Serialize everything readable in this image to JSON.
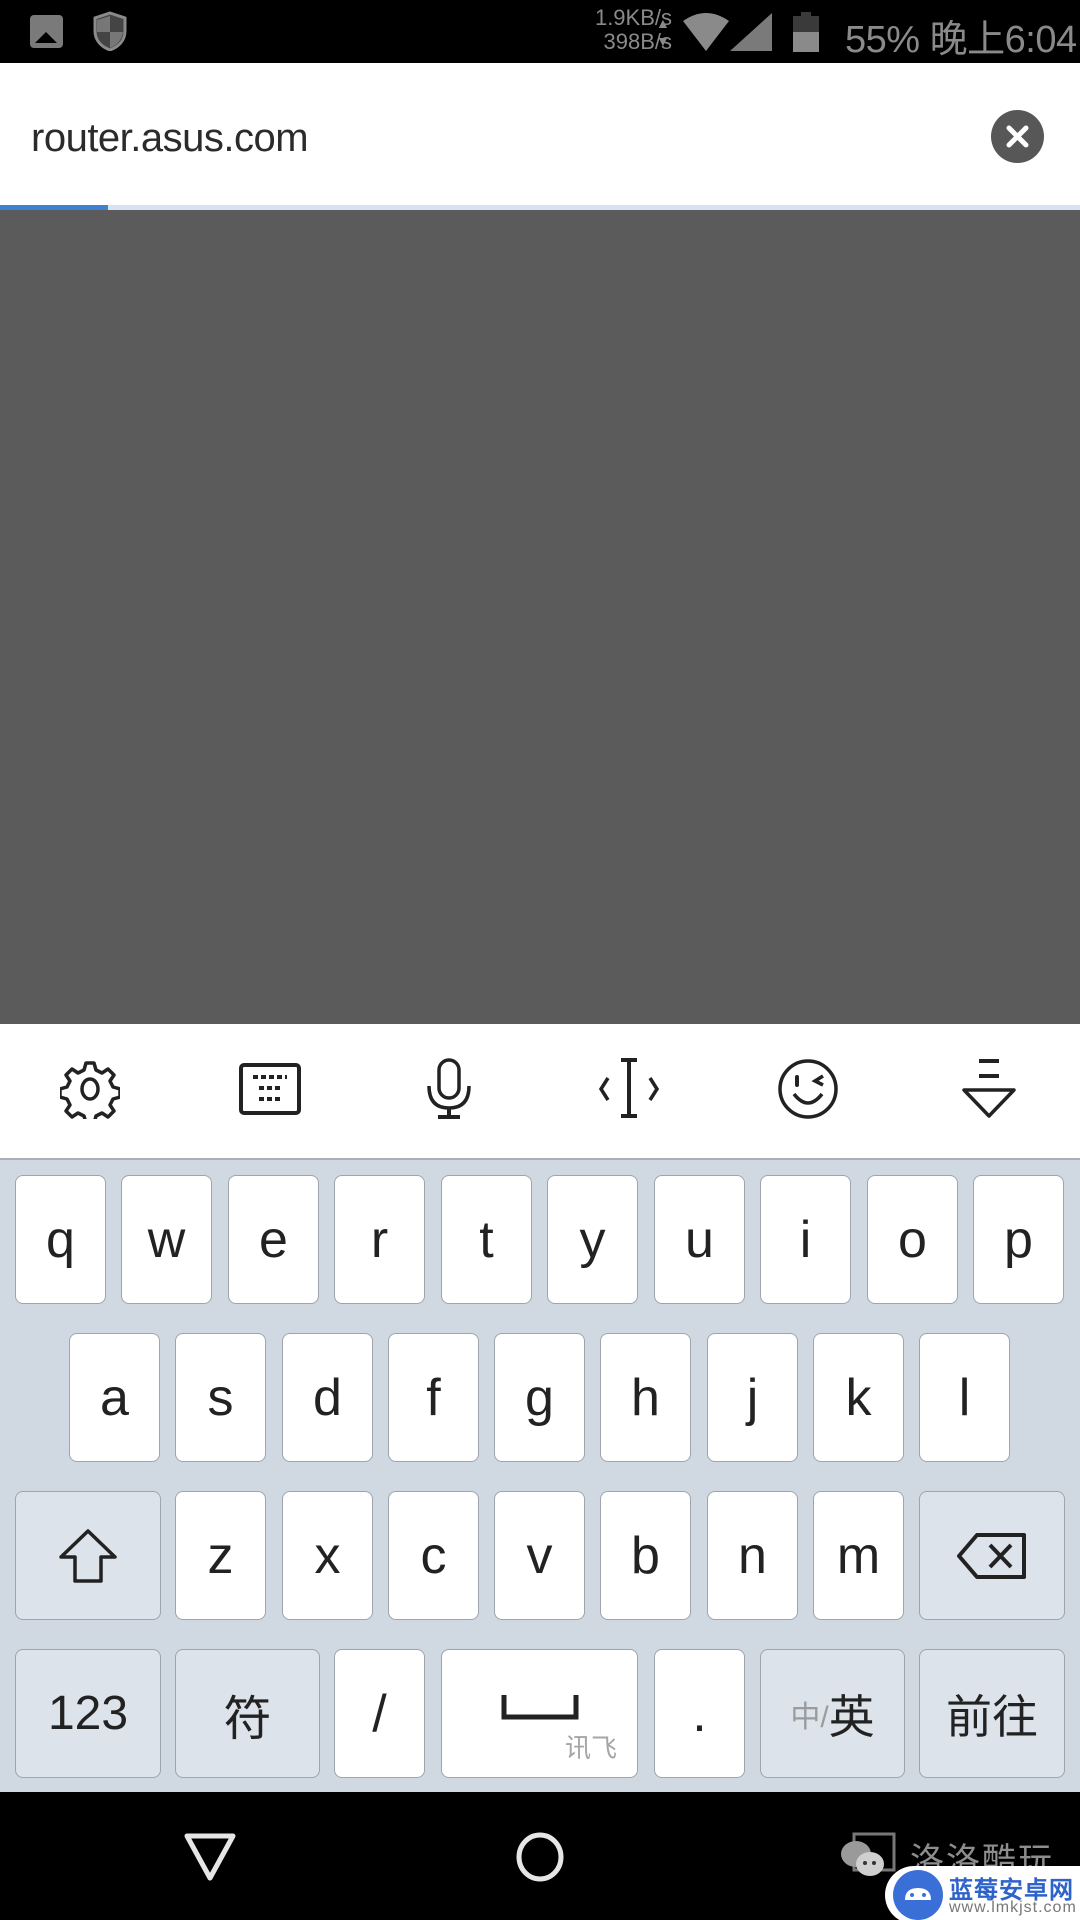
{
  "status_bar": {
    "icons": [
      "gallery-icon",
      "shield-icon",
      "wifi-icon",
      "cell-signal-icon",
      "battery-icon"
    ],
    "upload_speed": "1.9KB/s",
    "download_speed": "398B/s",
    "battery_percent": "55%",
    "time": "晚上6:04"
  },
  "url_bar": {
    "url": "router.asus.com",
    "clear_icon": "close-circle-icon",
    "load_progress": 0.1,
    "colors": {
      "progress": "#3f7fd4",
      "track": "#d6e2f5"
    }
  },
  "page": {
    "background": "#5b5b5b"
  },
  "keyboard_toolbar": {
    "tools": [
      {
        "name": "settings",
        "icon": "gear-icon"
      },
      {
        "name": "keyboard-layout",
        "icon": "keyboard-icon"
      },
      {
        "name": "voice-input",
        "icon": "microphone-icon"
      },
      {
        "name": "cursor-move",
        "icon": "text-cursor-icon"
      },
      {
        "name": "emoji",
        "icon": "wink-face-icon"
      },
      {
        "name": "hide-keyboard",
        "icon": "collapse-down-icon"
      }
    ]
  },
  "keyboard": {
    "row1": [
      "q",
      "w",
      "e",
      "r",
      "t",
      "y",
      "u",
      "i",
      "o",
      "p"
    ],
    "row2": [
      "a",
      "s",
      "d",
      "f",
      "g",
      "h",
      "j",
      "k",
      "l"
    ],
    "row3": [
      "z",
      "x",
      "c",
      "v",
      "b",
      "n",
      "m"
    ],
    "shift_icon": "shift-arrow-icon",
    "backspace_icon": "backspace-icon",
    "numbers_label": "123",
    "symbols_label": "符",
    "slash_label": "/",
    "space_sublabel": "讯飞",
    "period_label": ".",
    "lang_inactive": "中/",
    "lang_active": "英",
    "go_label": "前往"
  },
  "nav_bar": {
    "buttons": [
      "back-triangle-icon",
      "home-circle-icon"
    ]
  },
  "watermarks": {
    "wechat_account": "洛洛酷玩",
    "site_name": "蓝莓安卓网",
    "site_url": "www.lmkjst.com"
  }
}
